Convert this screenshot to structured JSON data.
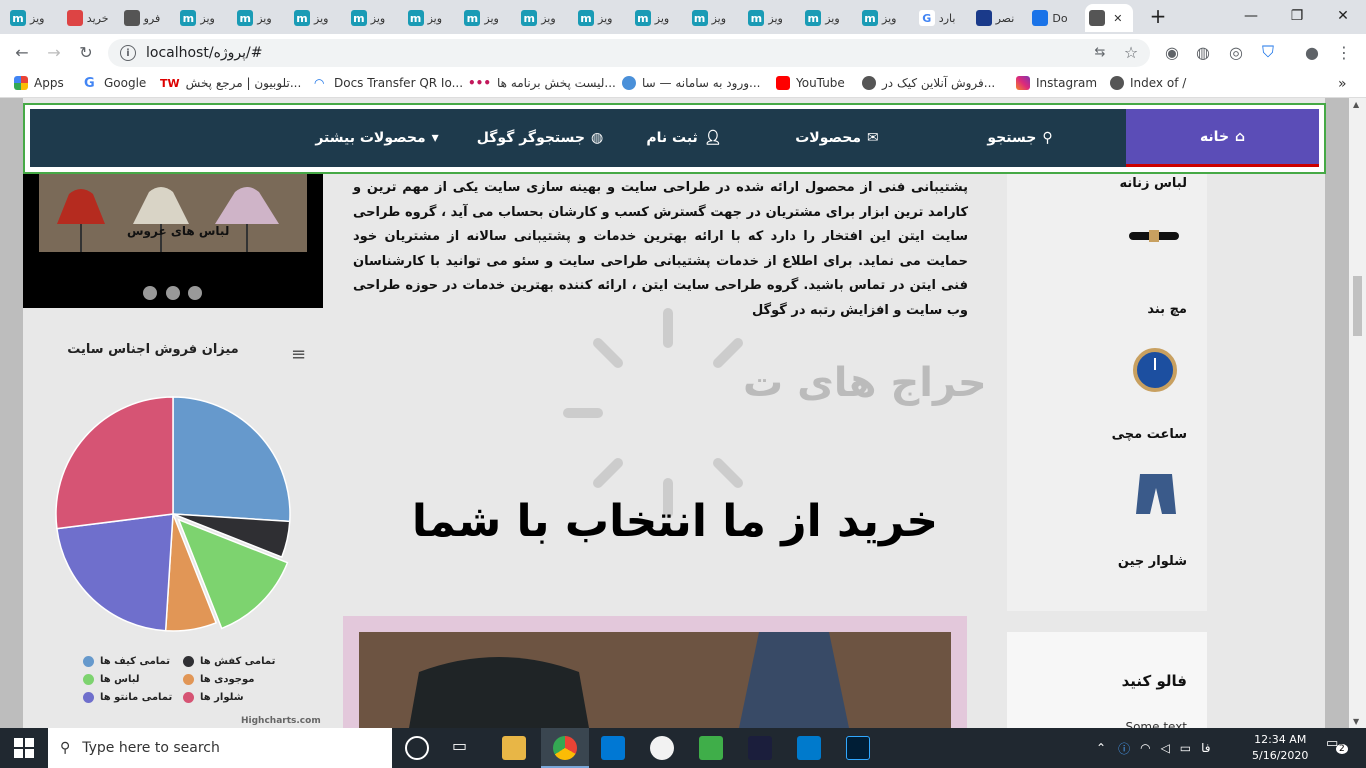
{
  "browser": {
    "tabs": [
      {
        "label": "ویز",
        "icon": "m-icon"
      },
      {
        "label": "خرید",
        "icon": "cake-icon"
      },
      {
        "label": "فرو",
        "icon": "globe-icon"
      },
      {
        "label": "ویز",
        "icon": "m-icon"
      },
      {
        "label": "ویز",
        "icon": "m-icon"
      },
      {
        "label": "ویز",
        "icon": "m-icon"
      },
      {
        "label": "ویز",
        "icon": "m-icon"
      },
      {
        "label": "ویز",
        "icon": "m-icon"
      },
      {
        "label": "ویز",
        "icon": "m-icon"
      },
      {
        "label": "ویز",
        "icon": "m-icon"
      },
      {
        "label": "ویز",
        "icon": "m-icon"
      },
      {
        "label": "ویز",
        "icon": "m-icon"
      },
      {
        "label": "ویز",
        "icon": "m-icon"
      },
      {
        "label": "ویز",
        "icon": "m-icon"
      },
      {
        "label": "ویز",
        "icon": "m-icon"
      },
      {
        "label": "ویز",
        "icon": "m-icon"
      },
      {
        "label": "بارد",
        "icon": "google-icon"
      },
      {
        "label": "نصر",
        "icon": "star-icon"
      },
      {
        "label": "Do",
        "icon": "download-icon"
      },
      {
        "label": "",
        "icon": "globe-icon"
      }
    ],
    "url": "localhost/پروژه/#",
    "bookmarks": [
      "Apps",
      "Google",
      "تلوبیون | مرجع پخش...",
      "Docs Transfer QR Io...",
      "لیست پخش برنامه ها...",
      "ورود به سامانه — سا...",
      "YouTube",
      "فروش آنلاین کیک در...",
      "Instagram",
      "Index of /"
    ],
    "bookmark_tw": "TW"
  },
  "nav": {
    "home": "خانه",
    "search": "جستجو",
    "products": "محصولات",
    "register": "ثبت نام",
    "google": "جستجوگر گوگل",
    "more": "محصولات بیشتر"
  },
  "slider": {
    "caption": "لباس های عروس"
  },
  "chart_panel": {
    "title": "میزان فروش اجناس سایت",
    "credit": "Highcharts.com"
  },
  "chart_data": {
    "type": "pie",
    "title": "میزان فروش اجناس سایت",
    "series": [
      {
        "name": "تمامی کیف ها",
        "value": 26,
        "color": "#6699cc"
      },
      {
        "name": "تمامی کفش ها",
        "value": 5,
        "color": "#2f2f33"
      },
      {
        "name": "لباس ها",
        "value": 13,
        "color": "#7dd36f"
      },
      {
        "name": "موجودی ها",
        "value": 7,
        "color": "#e19656"
      },
      {
        "name": "تمامی مانتو ها",
        "value": 22,
        "color": "#6f6fcc"
      },
      {
        "name": "شلوار ها",
        "value": 27,
        "color": "#d65474"
      }
    ],
    "sliced": "لباس ها",
    "legend": "bottom"
  },
  "main": {
    "paragraph": "پشتیبانی فنی از محصول ارائه شده در طراحی سایت و بهینه سازی سایت یکی از مهم ترین و کارامد ترین ابزار برای مشتریان در جهت گسترش کسب و کارشان بحساب می آید ، گروه طراحی سایت ایتن این افتخار را دارد که با ارائه بهترین خدمات و پشتیبانی سالانه از مشتریان خود حمایت می نماید. برای اطلاع از خدمات پشتیبانی طراحی سایت و سئو می توانید با کارشناسان فنی ایتن در تماس باشید. گروه طراحی سایت ایتن ، ارائه کننده بهترین خدمات در حوزه طراحی وب سایت و افزایش رتبه در گوگل",
    "watermark": "حراج های ت",
    "headline": "خرید از ما انتخاب با شما"
  },
  "categories": [
    {
      "label": "لباس زنانه"
    },
    {
      "label": "مچ بند"
    },
    {
      "label": "ساعت مچی"
    },
    {
      "label": "شلوار جین"
    }
  ],
  "follow": {
    "title": "فالو کنید",
    "text": "Some text"
  },
  "taskbar": {
    "search_placeholder": "Type here to search",
    "lang": "فا",
    "time": "12:34 AM",
    "date": "5/16/2020",
    "notifications": "2"
  }
}
